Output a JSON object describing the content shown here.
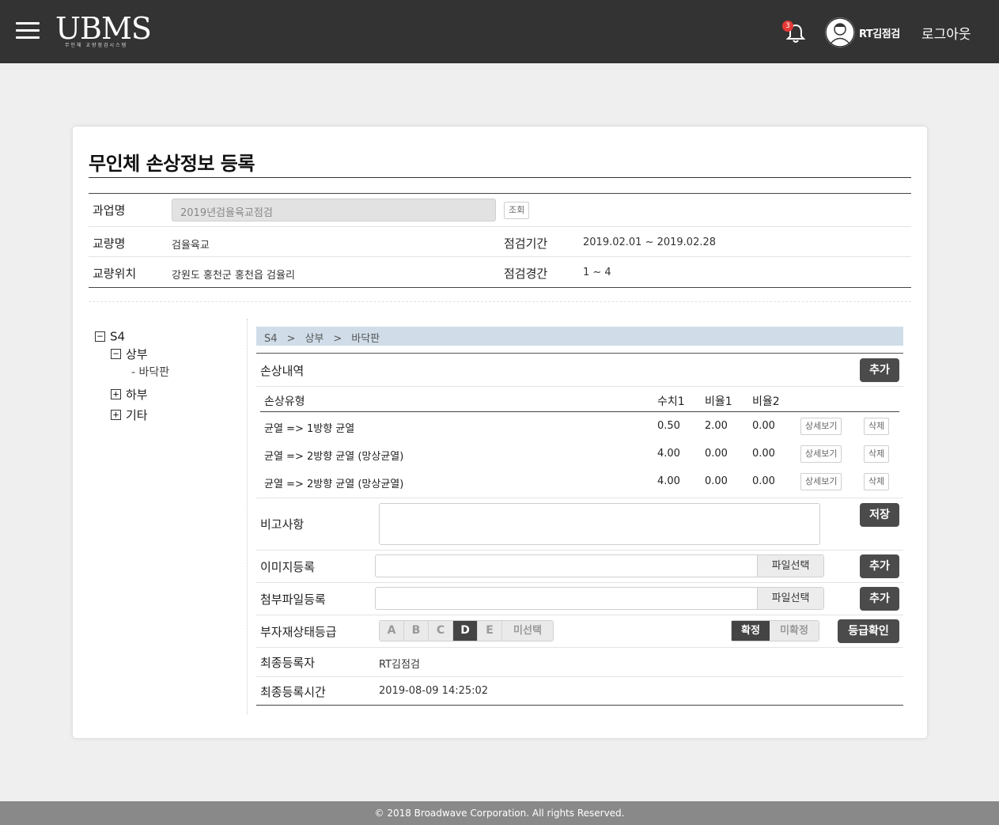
{
  "header": {
    "logo_text": "UBMS",
    "logo_sub": "무인체 교량점검시스템",
    "notification_count": "3",
    "username": "RT김점검",
    "logout_label": "로그아웃"
  },
  "page": {
    "title": "무인체 손상정보 등록"
  },
  "info": {
    "project_label": "과업명",
    "project_value": "2019년검율육교점검",
    "lookup_label": "조회",
    "bridge_label": "교량명",
    "bridge_value": "검율육교",
    "period_label": "점검기간",
    "period_value": "2019.02.01 ~ 2019.02.28",
    "location_label": "교량위치",
    "location_value": "강원도 홍천군 홍천읍 검율리",
    "span_label": "점검경간",
    "span_value": "1 ~ 4"
  },
  "tree": {
    "root": "S4",
    "upper": "상부",
    "upper_child": "- 바닥판",
    "lower": "하부",
    "etc": "기타"
  },
  "breadcrumb": [
    "S4",
    ">",
    "상부",
    ">",
    "바닥판"
  ],
  "damage": {
    "section_label": "손상내역",
    "add_label": "추가",
    "headers": [
      "손상유형",
      "수치1",
      "비율1",
      "비율2"
    ],
    "rows": [
      {
        "type": "균열 => 1방향 균열",
        "v1": "0.50",
        "r1": "2.00",
        "r2": "0.00"
      },
      {
        "type": "균열 => 2방향 균열 (망상균열)",
        "v1": "4.00",
        "r1": "0.00",
        "r2": "0.00"
      },
      {
        "type": "균열 => 2방향 균열 (망상균열)",
        "v1": "4.00",
        "r1": "0.00",
        "r2": "0.00"
      }
    ],
    "detail_label": "상세보기",
    "delete_label": "삭제"
  },
  "remark": {
    "label": "비고사항",
    "save_label": "저장"
  },
  "image": {
    "label": "이미지등록",
    "file_btn": "파일선택",
    "add_label": "추가"
  },
  "attach": {
    "label": "첨부파일등록",
    "file_btn": "파일선택",
    "add_label": "추가"
  },
  "grade": {
    "label": "부자재상태등급",
    "options": [
      "A",
      "B",
      "C",
      "D",
      "E",
      "미선택"
    ],
    "selected": "D",
    "confirm_options": [
      "확정",
      "미확정"
    ],
    "confirm_selected": "확정",
    "check_label": "등급확인"
  },
  "last_user": {
    "label": "최종등록자",
    "value": "RT김점검"
  },
  "last_time": {
    "label": "최종등록시간",
    "value": "2019-08-09 14:25:02"
  },
  "footer": {
    "text": "© 2018 Broadwave Corporation. All rights Reserved."
  },
  "colors": {
    "topbar": "#333333",
    "breadcrumb_bg": "#d0dde9",
    "dark_button": "#4b4b4b",
    "footer": "#898989",
    "badge": "#e53935"
  }
}
